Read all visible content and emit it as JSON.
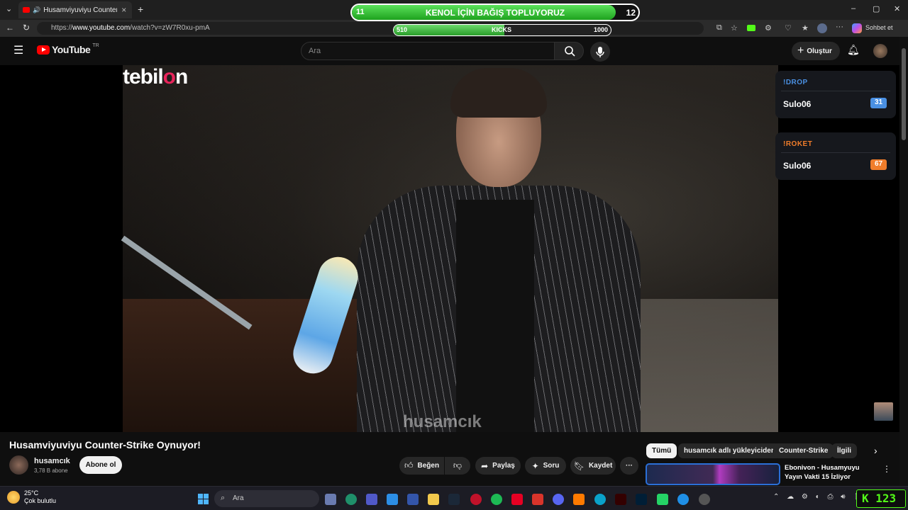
{
  "browser": {
    "tab_title": "Husamviyuviyu Counter-Strike",
    "tab_close": "×",
    "new_tab": "+",
    "url_prefix": "https://",
    "url_host": "www.youtube.com",
    "url_path": "/watch?v=zW7R0xu-pmA",
    "copilot_label": "Sohbet et",
    "window_controls": [
      "–",
      "▢",
      "✕"
    ]
  },
  "overlay": {
    "donation": {
      "label": "KENOL İÇİN BAĞIŞ TOPLUYORUZ",
      "left_value": "11",
      "right_value": "12",
      "progress_fraction": 0.92
    },
    "kicks": {
      "label": "KICKS",
      "min": "510",
      "max": "1000",
      "progress_fraction": 0.51
    },
    "brand": "tebilon",
    "watermark": "husamcık"
  },
  "header": {
    "logo_text": "YouTube",
    "region": "TR",
    "search_placeholder": "Ara",
    "create_label": "Oluştur"
  },
  "commands": [
    {
      "command": "!DROP",
      "user": "Sulo06",
      "count": "31",
      "color": "#4a90e2",
      "badge_color": "#4a90e2"
    },
    {
      "command": "!ROKET",
      "user": "Sulo06",
      "count": "67",
      "color": "#f07d2b",
      "badge_color": "#f07d2b"
    }
  ],
  "video": {
    "title": "Husamviyuviyu Counter-Strike Oynuyor!",
    "channel": "husamcık",
    "subscribers": "3,78 B abone",
    "subscribe_label": "Abone ol",
    "like_label": "Beğen",
    "share_label": "Paylaş",
    "ask_label": "Soru",
    "save_label": "Kaydet",
    "more_label": "···"
  },
  "chips": [
    "Tümü",
    "husamcık adlı yükleyiciden",
    "Counter-Strike",
    "İlgili"
  ],
  "recommendation": {
    "title": "Ebonivon - Husamyuyu Yayın Vakti 15 İzliyor"
  },
  "taskbar": {
    "temperature": "25°C",
    "weather": "Çok bulutlu",
    "search_label": "Ara",
    "counter": "123"
  },
  "colors": {
    "youtube_red": "#ff0000",
    "kick_green": "#53fc18",
    "donation_green": "#3cc93c"
  }
}
